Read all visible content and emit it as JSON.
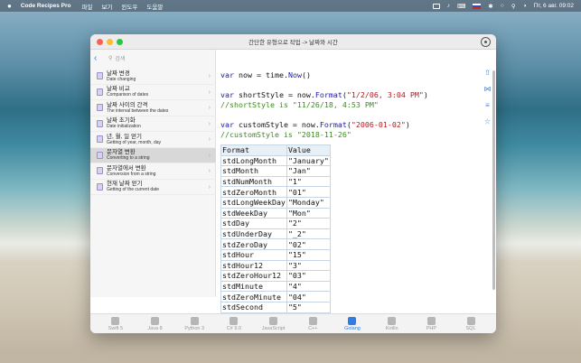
{
  "menubar": {
    "apple": "",
    "app": "Code Recipes Pro",
    "menus": [
      "파일",
      "보기",
      "윈도우",
      "도움말"
    ],
    "clock": "Пт, 6 авг. 09:02"
  },
  "window": {
    "title": "간단한 유형으로 작업 -> 날짜와 시간",
    "search_placeholder": "검색"
  },
  "sidebar": {
    "items": [
      {
        "title": "날짜 변경",
        "subtitle": "Date changing"
      },
      {
        "title": "날짜 비교",
        "subtitle": "Comparison of dates"
      },
      {
        "title": "날짜 사이의 간격",
        "subtitle": "The interval between the dates"
      },
      {
        "title": "날짜 초기화",
        "subtitle": "Date initialization"
      },
      {
        "title": "년, 월, 일 얻기",
        "subtitle": "Getting of year, month, day"
      },
      {
        "title": "문자열 변환",
        "subtitle": "Converting to a string"
      },
      {
        "title": "문자열에서 변환",
        "subtitle": "Conversion from a string"
      },
      {
        "title": "현재 날짜 얻기",
        "subtitle": "Getting of the current date"
      }
    ],
    "selected_index": 5
  },
  "code": {
    "line1": {
      "kw": "var",
      "a": " now = time.",
      "b": "Now",
      "c": "()"
    },
    "line2": {
      "kw": "var",
      "a": " shortStyle = now.",
      "b": "Format",
      "c": "(",
      "s": "\"1/2/06, 3:04 PM\"",
      "d": ")"
    },
    "line3": "//shortStyle is \"11/26/18, 4:53 PM\"",
    "line4": {
      "kw": "var",
      "a": " customStyle = now.",
      "b": "Format",
      "c": "(",
      "s": "\"2006-01-02\"",
      "d": ")"
    },
    "line5": "//customStyle is \"2018-11-26\""
  },
  "table": {
    "headers": [
      "Format",
      "Value"
    ],
    "rows": [
      [
        "stdLongMonth",
        "\"January\""
      ],
      [
        "stdMonth",
        "\"Jan\""
      ],
      [
        "stdNumMonth",
        "\"1\""
      ],
      [
        "stdZeroMonth",
        "\"01\""
      ],
      [
        "stdLongWeekDay",
        "\"Monday\""
      ],
      [
        "stdWeekDay",
        "\"Mon\""
      ],
      [
        "stdDay",
        "\"2\""
      ],
      [
        "stdUnderDay",
        "\"_2\""
      ],
      [
        "stdZeroDay",
        "\"02\""
      ],
      [
        "stdHour",
        "\"15\""
      ],
      [
        "stdHour12",
        "\"3\""
      ],
      [
        "stdZeroHour12",
        "\"03\""
      ],
      [
        "stdMinute",
        "\"4\""
      ],
      [
        "stdZeroMinute",
        "\"04\""
      ],
      [
        "stdSecond",
        "\"5\""
      ]
    ]
  },
  "tabs": [
    "Swift 5",
    "Java 8",
    "Python 3",
    "C# 9.0",
    "JavaScript",
    "C++",
    "Golang",
    "Kotlin",
    "PHP",
    "SQL"
  ],
  "active_tab": "Golang",
  "colors": {
    "accent": "#2f7ee6",
    "close": "#fe5f57",
    "minimize": "#febc2e",
    "zoom": "#28c840"
  }
}
